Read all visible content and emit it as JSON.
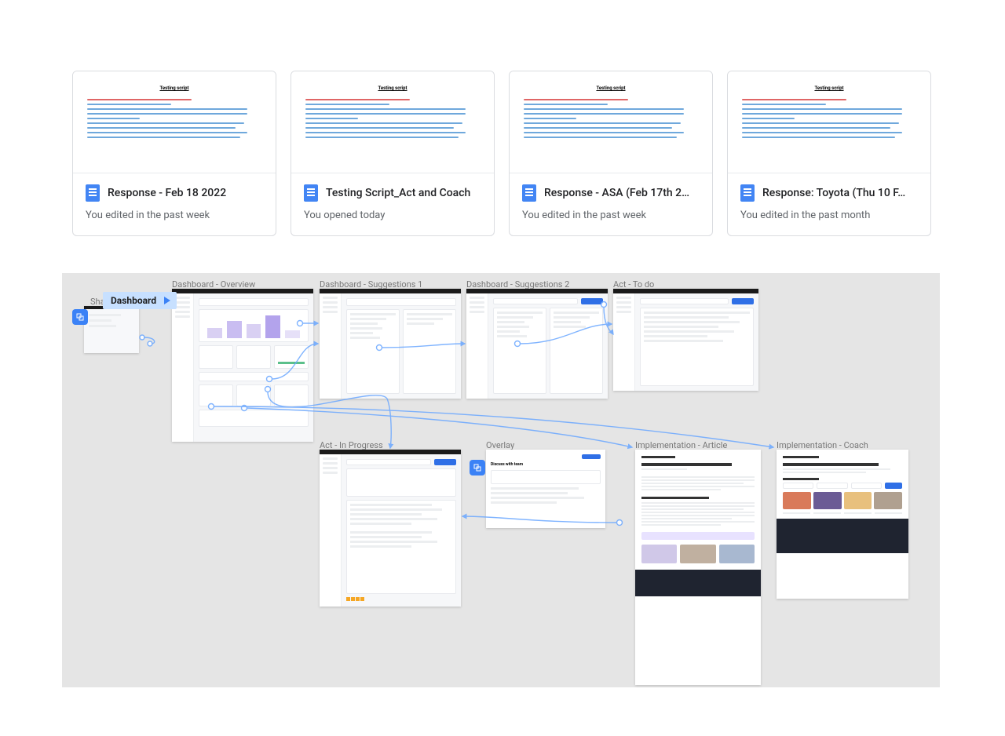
{
  "docs": [
    {
      "title": "Response - Feb 18 2022",
      "subtitle": "You edited in the past week",
      "thumb_heading": "Testing script"
    },
    {
      "title": "Testing Script_Act and Coach",
      "subtitle": "You opened today",
      "thumb_heading": "Testing script"
    },
    {
      "title": "Response - ASA (Feb 17th 2…",
      "subtitle": "You edited in the past week",
      "thumb_heading": "Testing script"
    },
    {
      "title": "Response: Toyota (Thu 10 F…",
      "subtitle": "You edited in the past month",
      "thumb_heading": "Testing script"
    }
  ],
  "canvas": {
    "pill_label": "Dashboard",
    "truncated_label": "Sha",
    "frames": {
      "dashboard_overview": "Dashboard - Overview",
      "dashboard_sug1": "Dashboard - Suggestions 1",
      "dashboard_sug2": "Dashboard - Suggestions 2",
      "act_todo": "Act - To do",
      "act_inprogress": "Act - In Progress",
      "overlay": "Overlay",
      "impl_article": "Implementation - Article",
      "impl_coach": "Implementation - Coach"
    },
    "overlay_text": "Discuss with team"
  }
}
